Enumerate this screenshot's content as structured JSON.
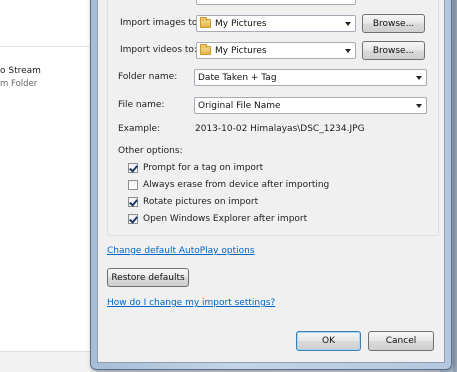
{
  "background_app": {
    "stream_label": "o Stream",
    "folder_label": "m Folder"
  },
  "dialog": {
    "import_images": {
      "label": "Import images to:",
      "value": "My Pictures",
      "browse": "Browse..."
    },
    "import_videos": {
      "label": "Import videos to:",
      "value": "My Pictures",
      "browse": "Browse..."
    },
    "folder_name": {
      "label": "Folder name:",
      "value": "Date Taken + Tag"
    },
    "file_name": {
      "label": "File name:",
      "value": "Original File Name"
    },
    "example": {
      "label": "Example:",
      "value": "2013-10-02 Himalayas\\DSC_1234.JPG"
    },
    "other_options": {
      "label": "Other options:",
      "items": [
        {
          "label": "Prompt for a tag on import",
          "checked": true
        },
        {
          "label": "Always erase from device after importing",
          "checked": false
        },
        {
          "label": "Rotate pictures on import",
          "checked": true
        },
        {
          "label": "Open Windows Explorer after import",
          "checked": true
        }
      ]
    },
    "autoplay_link": "Change default AutoPlay options",
    "restore_defaults": "Restore defaults",
    "help_link": "How do I change my import settings?",
    "ok": "OK",
    "cancel": "Cancel"
  }
}
